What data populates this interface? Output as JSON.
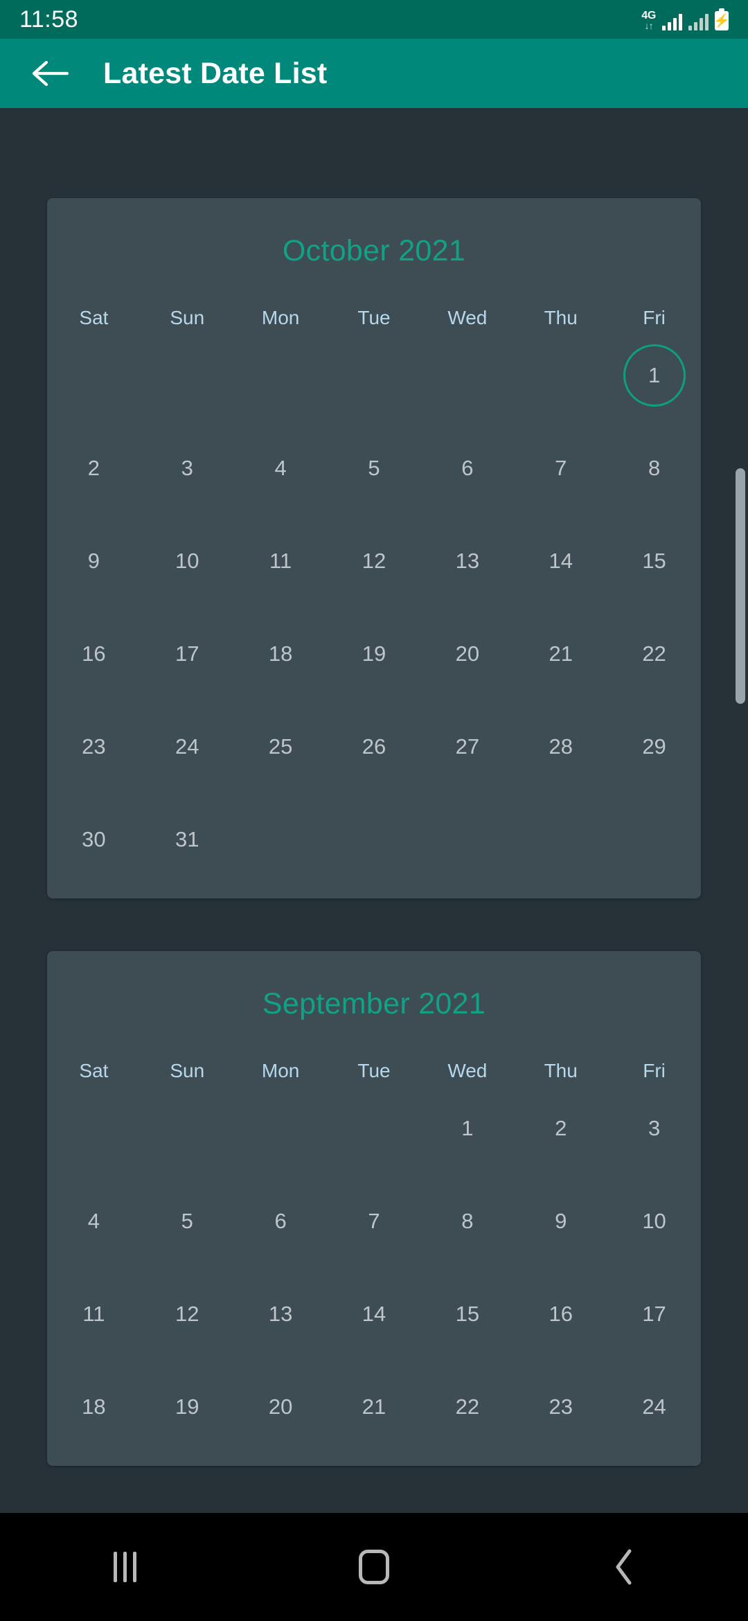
{
  "status_bar": {
    "clock": "11:58",
    "network_label": "4G",
    "network_arrows": "↓↑",
    "battery_glyph": "⚡",
    "icons": [
      "4g-icon",
      "signal-bars-icon",
      "signal-bars-secondary-icon",
      "battery-charging-icon"
    ]
  },
  "app_bar": {
    "title": "Latest Date List",
    "back_icon": "arrow-left-icon"
  },
  "theme": {
    "status_bar_bg": "#006B5B",
    "app_bar_bg": "#00897B",
    "page_bg": "#263238",
    "card_bg": "#3E4C54",
    "month_title_color": "#11A285",
    "dow_color": "#B7D8EB",
    "day_color": "#BFC6C9",
    "today_ring_color": "#0E9E80",
    "nav_bar_bg": "#000000",
    "scrollbar_color": "#9AA5A9"
  },
  "weekday_headers": [
    "Sat",
    "Sun",
    "Mon",
    "Tue",
    "Wed",
    "Thu",
    "Fri"
  ],
  "months": [
    {
      "title": "October 2021",
      "weeks": [
        [
          "",
          "",
          "",
          "",
          "",
          "",
          "1"
        ],
        [
          "2",
          "3",
          "4",
          "5",
          "6",
          "7",
          "8"
        ],
        [
          "9",
          "10",
          "11",
          "12",
          "13",
          "14",
          "15"
        ],
        [
          "16",
          "17",
          "18",
          "19",
          "20",
          "21",
          "22"
        ],
        [
          "23",
          "24",
          "25",
          "26",
          "27",
          "28",
          "29"
        ],
        [
          "30",
          "31",
          "",
          "",
          "",
          "",
          ""
        ]
      ],
      "highlighted_day": "1"
    },
    {
      "title": "September 2021",
      "weeks": [
        [
          "",
          "",
          "",
          "",
          "1",
          "2",
          "3"
        ],
        [
          "4",
          "5",
          "6",
          "7",
          "8",
          "9",
          "10"
        ],
        [
          "11",
          "12",
          "13",
          "14",
          "15",
          "16",
          "17"
        ],
        [
          "18",
          "19",
          "20",
          "21",
          "22",
          "23",
          "24"
        ]
      ],
      "highlighted_day": ""
    }
  ],
  "nav_bar": {
    "recents_label": "recents-icon",
    "home_label": "home-icon",
    "back_label": "back-icon"
  }
}
